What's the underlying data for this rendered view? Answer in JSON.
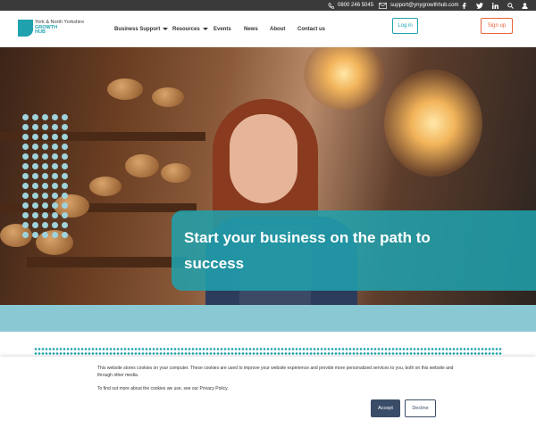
{
  "topbar": {
    "phone": "0800 246 5045",
    "email": "support@ynygrowthhub.com",
    "social_icons": [
      "facebook-icon",
      "twitter-icon",
      "linkedin-icon"
    ],
    "utility_icons": [
      "search-icon",
      "user-icon"
    ]
  },
  "header": {
    "logo": {
      "line1": "York & North Yorkshire",
      "line2": "GROWTH",
      "line3": "HUB"
    },
    "nav": [
      {
        "label": "Business Support",
        "dropdown": true
      },
      {
        "label": "Resources",
        "dropdown": true
      },
      {
        "label": "Events",
        "dropdown": false
      },
      {
        "label": "News",
        "dropdown": false
      },
      {
        "label": "About",
        "dropdown": false
      },
      {
        "label": "Contact us",
        "dropdown": false
      }
    ],
    "login_label": "Log in",
    "signup_label": "Sign up"
  },
  "hero": {
    "title": "Start your business on the path to success"
  },
  "cookie_banner": {
    "text1": "This website stores cookies on your computer. These cookies are used to improve your website experience and provide more personalized services to you, both on this website and through other media.",
    "text2": "To find out more about the cookies we use, see our Privacy Policy.",
    "accept_label": "Accept",
    "decline_label": "Decline"
  },
  "colors": {
    "brand_teal": "#1fa2ae",
    "signup_orange": "#e8643a",
    "topbar_dark": "#3a3a3a",
    "light_teal_strip": "#8ac8d4",
    "accept_navy": "#3a4d68"
  }
}
